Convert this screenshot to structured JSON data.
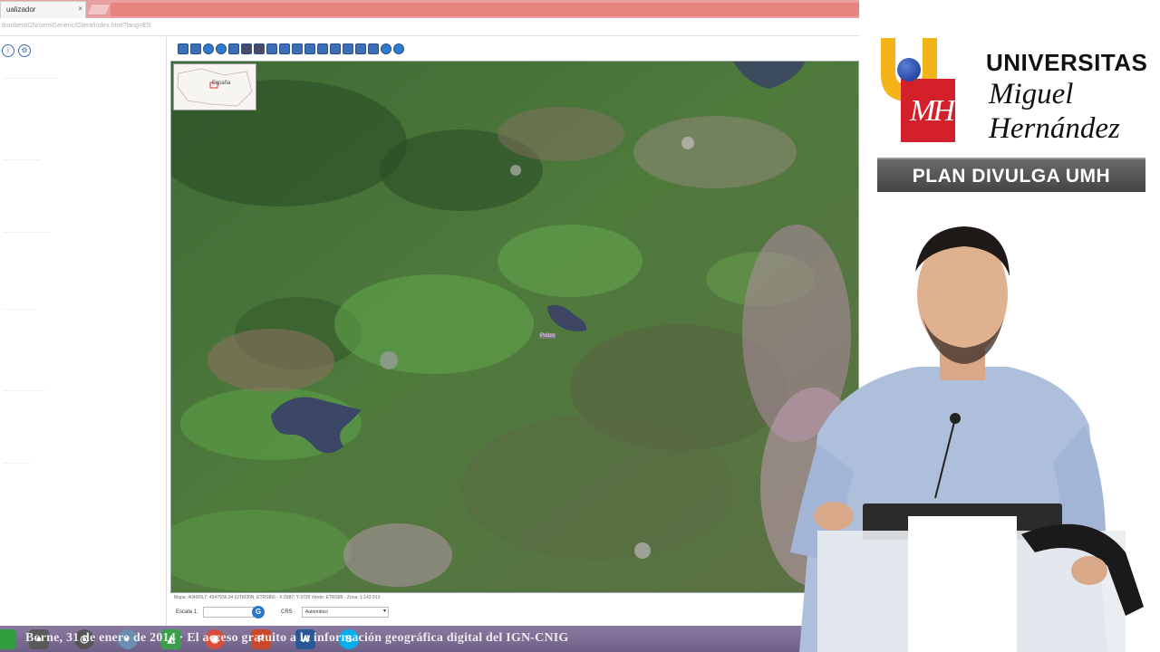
{
  "browser": {
    "tab_title": "ualizador",
    "tab_close": "×",
    "url": "ibonbestIGN/semiGeneric/Client/index.html?lang=ES"
  },
  "left_panel": {
    "icons": [
      "info-icon",
      "settings-icon"
    ]
  },
  "map": {
    "overview_label": "España",
    "place_label": "Polizo",
    "status_text": "Mapa: 404009,7; 4547936,04 (UTM30N; ETRS89) - X:2987; Y:3728 Verde: ETRS89 - Zona: 1:143 913"
  },
  "bottom_bar": {
    "scale_label": "Escala 1:",
    "scale_go": "G",
    "crs_label": "CRS",
    "crs_value": "Automático",
    "crs_caret": "▾"
  },
  "taskbar": {
    "ticker_text": "Borne, 31 de enero de 2014 · El acceso gratuito a la información geográfica digital del IGN-CNIG",
    "close": "x",
    "items": [
      {
        "name": "start",
        "glyph": "",
        "color": "#2e9e3e"
      },
      {
        "name": "media",
        "glyph": "●",
        "color": "#555555"
      },
      {
        "name": "itunes",
        "glyph": "◐",
        "color": "#6a8fb0"
      },
      {
        "name": "feed",
        "glyph": "◭",
        "color": "#3b9e4a"
      },
      {
        "name": "chrome",
        "glyph": "◉",
        "color": "#d94b3b"
      },
      {
        "name": "powerpoint",
        "glyph": "P",
        "color": "#c9482b"
      },
      {
        "name": "word",
        "glyph": "W",
        "color": "#2b5797"
      },
      {
        "name": "skype",
        "glyph": "S",
        "color": "#00aff0"
      }
    ]
  },
  "brand": {
    "line1": "UNIVERSITAS",
    "line2": "Miguel",
    "line3": "Hernández",
    "mh": "MH",
    "plan": "PLAN DIVULGA UMH",
    "colors": {
      "yellow": "#f4b318",
      "red": "#d4202a",
      "blue": "#1c3f9e"
    }
  }
}
